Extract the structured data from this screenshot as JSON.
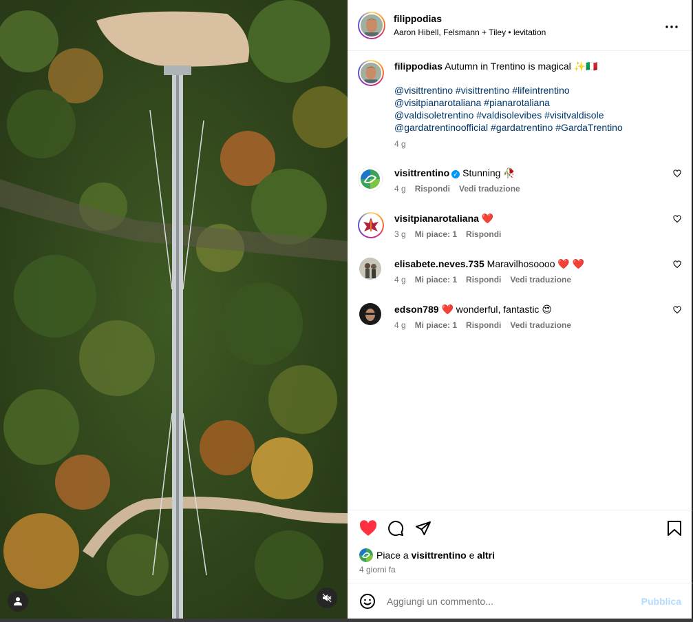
{
  "header": {
    "username": "filippodias",
    "audio": "Aaron Hibell, Felsmann + Tiley • levitation",
    "more_icon": "more-horizontal-icon"
  },
  "caption": {
    "username": "filippodias",
    "text": "Autumn in Trentino is magical ✨🇮🇹",
    "hashtag_lines": [
      "@visittrentino #visittrentino #lifeintrentino",
      "@visitpianarotaliana #pianarotaliana",
      "@valdisoletrentino #valdisolevibes #visitvaldisole",
      "@gardatrentinoofficial #gardatrentino #GardaTrentino"
    ],
    "time": "4 g"
  },
  "comments": [
    {
      "username": "visittrentino",
      "verified": true,
      "text": "Stunning 🥀",
      "time": "4 g",
      "likes": "",
      "reply": "Rispondi",
      "translate": "Vedi traduzione"
    },
    {
      "username": "visitpianarotaliana",
      "verified": false,
      "text": "❤️",
      "time": "3 g",
      "likes": "Mi piace: 1",
      "reply": "Rispondi",
      "translate": ""
    },
    {
      "username": "elisabete.neves.735",
      "verified": false,
      "text": "Maravilhosoooo ❤️ ❤️",
      "time": "4 g",
      "likes": "Mi piace: 1",
      "reply": "Rispondi",
      "translate": "Vedi traduzione"
    },
    {
      "username": "edson789",
      "verified": false,
      "text": "❤️ wonderful, fantastic 😍",
      "time": "4 g",
      "likes": "Mi piace: 1",
      "reply": "Rispondi",
      "translate": "Vedi traduzione"
    }
  ],
  "actions": {
    "liked": true,
    "like_color": "#ff3040",
    "likes_prefix": "Piace a",
    "likes_user": "visittrentino",
    "likes_joiner": "e",
    "likes_others": "altri",
    "posted_ago": "4 giorni fa"
  },
  "composer": {
    "placeholder": "Aggiungi un commento...",
    "publish_label": "Pubblica"
  },
  "colors": {
    "accent": "#0095f6",
    "link": "#00376b",
    "muted": "#737373"
  }
}
